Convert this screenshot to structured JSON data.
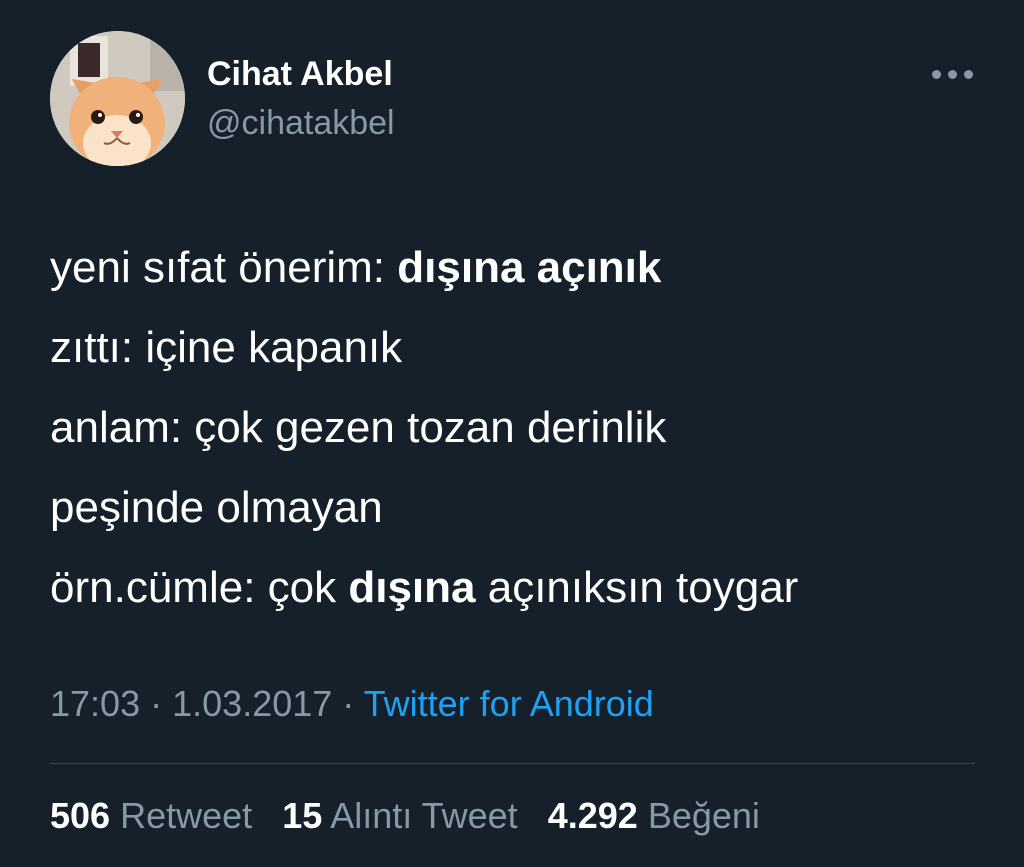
{
  "user": {
    "display_name": "Cihat Akbel",
    "handle": "@cihatakbel",
    "avatar_icon": "cat-avatar"
  },
  "menu": {
    "icon": "more-horizontal-icon"
  },
  "tweet": {
    "lines": [
      {
        "normal": "yeni sıfat önerim: ",
        "bold": "dışına açınık",
        "after": ""
      },
      {
        "normal": "zıttı: içine kapanık",
        "bold": "",
        "after": ""
      },
      {
        "normal": "anlam: çok gezen tozan derinlik",
        "bold": "",
        "after": ""
      },
      {
        "normal": "peşinde olmayan",
        "bold": "",
        "after": ""
      },
      {
        "normal": "örn.cümle: çok ",
        "bold": "dışına",
        "after": " açınıksın toygar"
      }
    ]
  },
  "meta": {
    "time": "17:03",
    "separator": "·",
    "date": "1.03.2017",
    "source": "Twitter for Android"
  },
  "stats": {
    "retweets": {
      "count": "506",
      "label": "Retweet"
    },
    "quotes": {
      "count": "15",
      "label": "Alıntı Tweet"
    },
    "likes": {
      "count": "4.292",
      "label": "Beğeni"
    }
  },
  "colors": {
    "background": "#15202b",
    "text_primary": "#ffffff",
    "text_secondary": "#8899a6",
    "link": "#1da1f2",
    "divider": "#38444d"
  }
}
